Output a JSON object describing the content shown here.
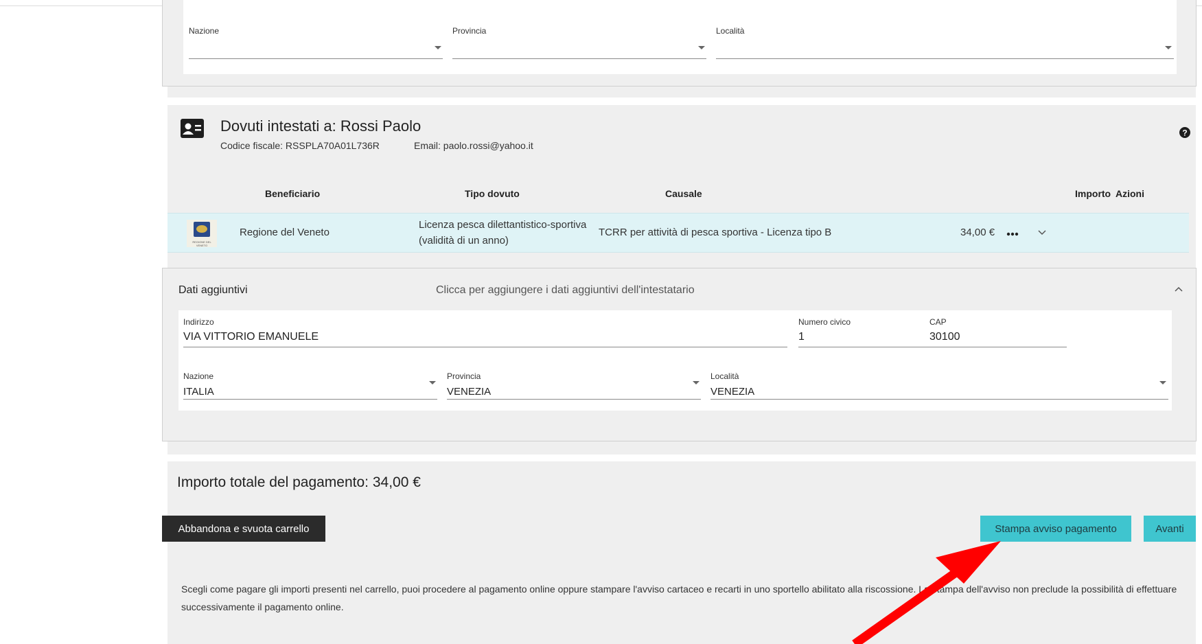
{
  "top_address": {
    "nazione_label": "Nazione",
    "provincia_label": "Provincia",
    "localita_label": "Località"
  },
  "intestatario": {
    "icon": "contact-card-icon",
    "title": "Dovuti intestati a: Rossi Paolo",
    "codice_fiscale": "Codice fiscale: RSSPLA70A01L736R",
    "email": "Email: paolo.rossi@yahoo.it",
    "help_icon": "question-circle-icon"
  },
  "table": {
    "headers": {
      "beneficiario": "Beneficiario",
      "tipo": "Tipo dovuto",
      "causale": "Causale",
      "importo": "Importo",
      "azioni": "Azioni"
    },
    "row": {
      "logo_text": "REGIONE DEL VENETO",
      "beneficiario": "Regione del Veneto",
      "tipo_line1": "Licenza pesca dilettantistico-sportiva",
      "tipo_line2": "(validità di un anno)",
      "causale": "TCRR per attività di pesca sportiva - Licenza tipo B",
      "importo": "34,00 €",
      "more_icon": "more-horizontal-icon",
      "expand_icon": "chevron-down-icon"
    }
  },
  "dati_aggiuntivi": {
    "title": "Dati aggiuntivi",
    "hint": "Clicca per aggiungere i dati aggiuntivi dell'intestatario",
    "collapse_icon": "chevron-up-icon",
    "indirizzo_label": "Indirizzo",
    "indirizzo_value": "VIA VITTORIO EMANUELE",
    "civico_label": "Numero civico",
    "civico_value": "1",
    "cap_label": "CAP",
    "cap_value": "30100",
    "nazione_label": "Nazione",
    "nazione_value": "ITALIA",
    "provincia_label": "Provincia",
    "provincia_value": "VENEZIA",
    "localita_label": "Località",
    "localita_value": "VENEZIA"
  },
  "totale": {
    "label": "Importo totale del pagamento: 34,00 €"
  },
  "buttons": {
    "abbandona": "Abbandona e svuota carrello",
    "stampa": "Stampa avviso pagamento",
    "avanti": "Avanti"
  },
  "note": "Scegli come pagare gli importi presenti nel carrello, puoi procedere al pagamento online oppure stampare l'avviso cartaceo e recarti in uno sportello abilitato alla riscossione. La stampa dell'avviso non preclude la possibilità di effettuare successivamente il pagamento online.",
  "annotation": {
    "arrow_color": "#ff0000"
  }
}
